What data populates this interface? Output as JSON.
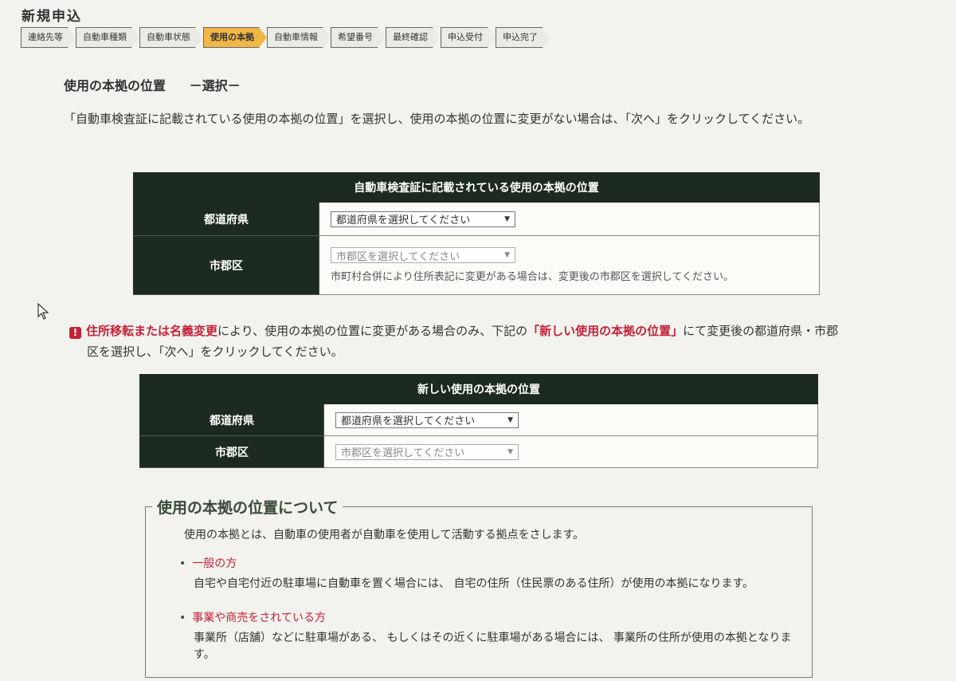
{
  "page": {
    "title": "新規申込"
  },
  "steps": [
    {
      "label": "連絡先等",
      "active": false
    },
    {
      "label": "自動車種類",
      "active": false
    },
    {
      "label": "自動車状態",
      "active": false
    },
    {
      "label": "使用の本拠",
      "active": true
    },
    {
      "label": "自動車情報",
      "active": false
    },
    {
      "label": "希望番号",
      "active": false
    },
    {
      "label": "最終確認",
      "active": false
    },
    {
      "label": "申込受付",
      "active": false
    },
    {
      "label": "申込完了",
      "active": false
    }
  ],
  "section": {
    "title": "使用の本拠の位置",
    "subtitle": "－選択－",
    "intro": "「自動車検査証に記載されている使用の本拠の位置」を選択し、使用の本拠の位置に変更がない場合は、「次へ」をクリックしてください。"
  },
  "current_table": {
    "caption": "自動車検査証に記載されている使用の本拠の位置",
    "prefecture_label": "都道府県",
    "prefecture_select": "都道府県を選択してください",
    "city_label": "市郡区",
    "city_select": "市郡区を選択してください",
    "city_note": "市町村合併により住所表記に変更がある場合は、変更後の市郡区を選択してください。"
  },
  "warning": {
    "icon": "!",
    "red1": "住所移転または名義変更",
    "text1": "により、使用の本拠の位置に変更がある場合のみ、下記の",
    "red2": "「新しい使用の本拠の位置」",
    "text2": "にて変更後の都道府県・市郡",
    "line2": "区を選択し、「次へ」をクリックしてください。"
  },
  "new_table": {
    "caption": "新しい使用の本拠の位置",
    "prefecture_label": "都道府県",
    "prefecture_select": "都道府県を選択してください",
    "city_label": "市郡区",
    "city_select": "市郡区を選択してください"
  },
  "about": {
    "title": "使用の本拠の位置について",
    "desc": "使用の本拠とは、自動車の使用者が自動車を使用して活動する拠点をさします。",
    "items": [
      {
        "label": "一般の方",
        "text": "自宅や自宅付近の駐車場に自動車を置く場合には、 自宅の住所（住民票のある住所）が使用の本拠になります。"
      },
      {
        "label": "事業や商売をされている方",
        "text": "事業所（店舗）などに駐車場がある、 もしくはその近くに駐車場がある場合には、 事業所の住所が使用の本拠となります。"
      }
    ]
  },
  "colors": {
    "header_dark": "#1d2a1f",
    "active_step": "#f0b646",
    "warning_red": "#c5223a"
  }
}
